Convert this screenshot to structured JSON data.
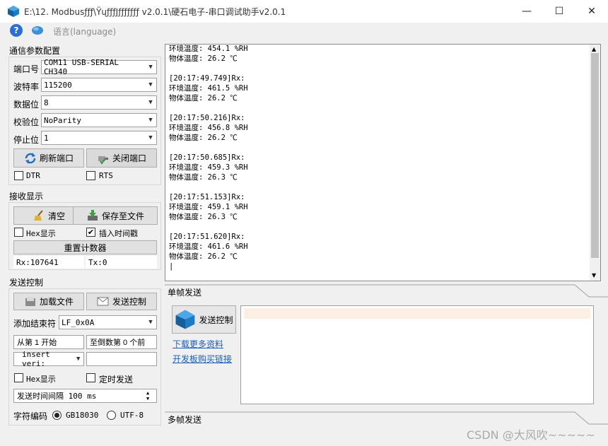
{
  "window": {
    "title": "E:\\12. Modbusƒƒƒ\\ŸųƒƒƒJƒƒƒƒƒƒƒ v2.0.1\\硬石电子-串口调试助手v2.0.1",
    "minimize": "—",
    "maximize": "☐",
    "close": "✕"
  },
  "menu": {
    "help": "?",
    "language": "语言(language)"
  },
  "comm": {
    "title": "通信参数配置",
    "port_label": "端口号",
    "port_value": "COM11 USB-SERIAL CH340",
    "baud_label": "波特率",
    "baud_value": "115200",
    "data_label": "数据位",
    "data_value": "8",
    "parity_label": "校验位",
    "parity_value": "NoParity",
    "stop_label": "停止位",
    "stop_value": "1",
    "refresh_label": "刷新端口",
    "close_label": "关闭端口",
    "dtr_label": "DTR",
    "rts_label": "RTS"
  },
  "recv": {
    "title": "接收显示",
    "clear_label": "清空",
    "save_label": "保存至文件",
    "hex_label": "Hex显示",
    "timestamp_label": "插入时间戳",
    "timestamp_checked": "✔",
    "reset_label": "重置计数器",
    "rx_label": "Rx:",
    "rx_value": "107641",
    "tx_label": "Tx:",
    "tx_value": "0",
    "lines": [
      "环境温度: 454.1 %RH",
      "物体温度: 26.2 ℃",
      "",
      "[20:17:49.749]Rx:",
      "环境温度: 461.5 %RH",
      "物体温度: 26.2 ℃",
      "",
      "[20:17:50.216]Rx:",
      "环境温度: 456.8 %RH",
      "物体温度: 26.2 ℃",
      "",
      "[20:17:50.685]Rx:",
      "环境温度: 459.3 %RH",
      "物体温度: 26.3 ℃",
      "",
      "[20:17:51.153]Rx:",
      "环境温度: 459.1 %RH",
      "物体温度: 26.3 ℃",
      "",
      "[20:17:51.620]Rx:",
      "环境温度: 461.6 %RH",
      "物体温度: 26.2 ℃"
    ]
  },
  "send": {
    "title": "发送控制",
    "load_label": "加载文件",
    "control_label": "发送控制",
    "terminator_label": "添加结束符",
    "terminator_value": "LF_0x0A",
    "from_label": "从第 1 开始",
    "to_label": "至倒数第 0 个前",
    "insert_value": "insert veri:",
    "insert_extra": "",
    "hex_label": "Hex显示",
    "timed_label": "定时发送",
    "interval_label": "发送时间间隔 100 ms",
    "encoding_label": "字符编码",
    "gb_label": "GB18030",
    "utf_label": "UTF-8"
  },
  "single": {
    "tab_label": "单帧发送",
    "send_button_label": "发送控制",
    "download_link": "下载更多资料",
    "buy_link": "开发板购买链接",
    "input_value": ""
  },
  "multi": {
    "tab_label": "多帧发送"
  },
  "watermark": "CSDN @大风吹~~~~~",
  "colors": {
    "link": "#1a5fbf",
    "accent": "#2a6fd1"
  }
}
